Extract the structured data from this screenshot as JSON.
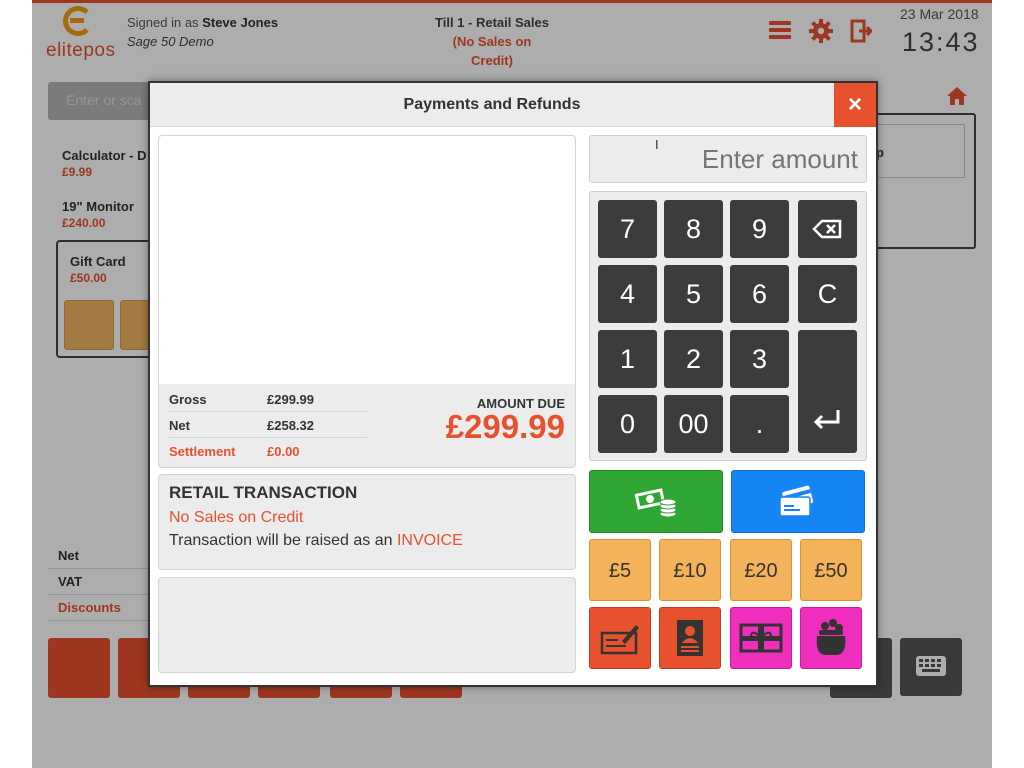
{
  "header": {
    "logo_text": "elitepos",
    "signed_in_prefix": "Signed in as",
    "user_name": "Steve Jones",
    "company": "Sage 50 Demo",
    "till_title": "Till 1 - Retail Sales",
    "till_subtitle": "(No Sales on Credit)",
    "date": "23 Mar 2018",
    "time": "13:43",
    "icons": [
      "menu-icon",
      "gear-icon",
      "logout-icon"
    ]
  },
  "background": {
    "search_placeholder": "Enter or sca",
    "basket_items": [
      {
        "name": "Calculator - D",
        "price": "£9.99"
      },
      {
        "name": "19\" Monitor",
        "price": "£240.00"
      },
      {
        "name": "Gift Card",
        "price": "£50.00"
      }
    ],
    "totals": [
      "Net",
      "VAT",
      "Discounts"
    ],
    "right_panel_fragment": "p"
  },
  "dialog": {
    "title": "Payments and Refunds",
    "close_label": "×",
    "summary": {
      "gross_label": "Gross",
      "gross_value": "£299.99",
      "net_label": "Net",
      "net_value": "£258.32",
      "settlement_label": "Settlement",
      "settlement_value": "£0.00",
      "amount_due_label": "AMOUNT DUE",
      "amount_due_value": "£299.99"
    },
    "transaction": {
      "heading": "RETAIL TRANSACTION",
      "line1": "No Sales on Credit",
      "line2_prefix": "Transaction will be raised as an",
      "line2_highlight": "INVOICE"
    },
    "amount_placeholder": "Enter amount",
    "keys": {
      "k7": "7",
      "k8": "8",
      "k9": "9",
      "k4": "4",
      "k5": "5",
      "k6": "6",
      "clear": "C",
      "k1": "1",
      "k2": "2",
      "k3": "3",
      "k0": "0",
      "k00": "00",
      "dot": "."
    },
    "quick_amounts": [
      "£5",
      "£10",
      "£20",
      "£50"
    ],
    "payment_methods": [
      "cash-icon",
      "card-icon",
      "cheque-icon",
      "account-icon",
      "gift-voucher-icon",
      "loyalty-pot-icon"
    ],
    "colors": {
      "accent": "#e8512e",
      "cash": "#2fa534",
      "card": "#1786f5",
      "quick": "#f4b35a",
      "pink": "#f02ebd",
      "key": "#3c3c3c"
    }
  }
}
